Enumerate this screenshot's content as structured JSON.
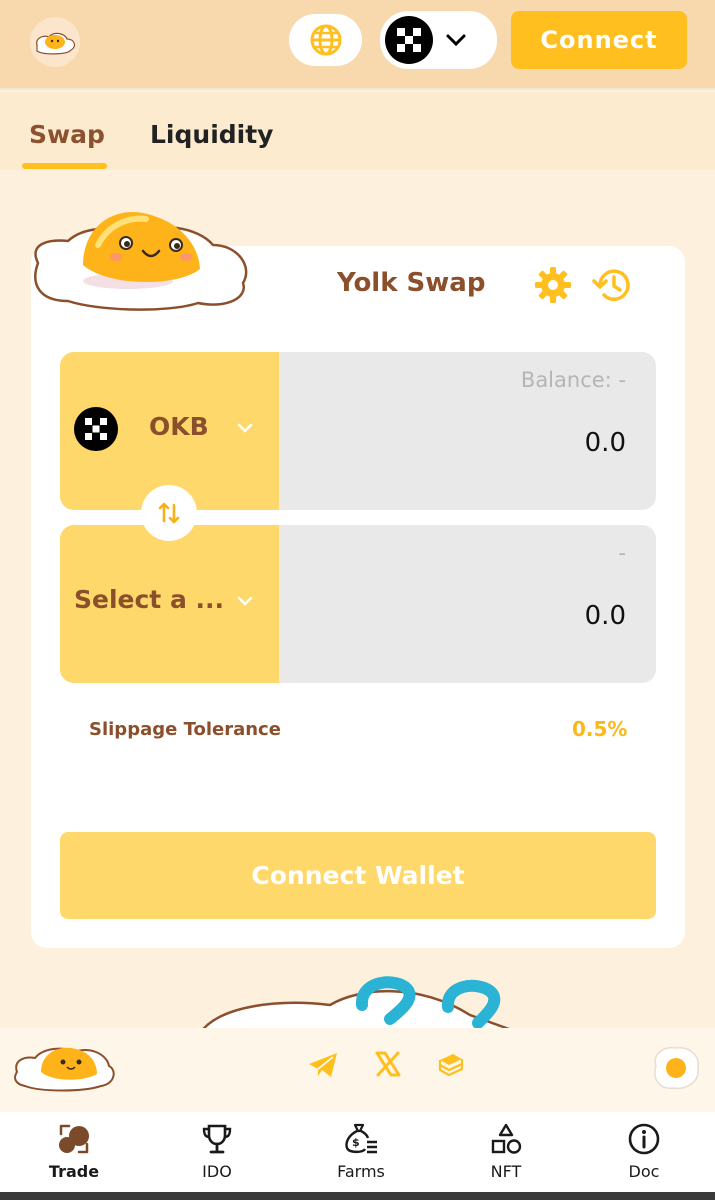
{
  "header": {
    "connect_label": "Connect",
    "chain_token": "OKB"
  },
  "tabs": [
    {
      "label": "Swap",
      "active": true
    },
    {
      "label": "Liquidity",
      "active": false
    }
  ],
  "card": {
    "title": "Yolk Swap",
    "from": {
      "token": "OKB",
      "balance": "Balance: -",
      "amount": "0.0"
    },
    "to": {
      "token": "Select a ...",
      "balance": "-",
      "amount": "0.0"
    },
    "slippage_label": "Slippage Tolerance",
    "slippage_value": "0.5%",
    "connect_wallet_label": "Connect Wallet"
  },
  "nav": [
    {
      "label": "Trade",
      "icon": "trade-icon",
      "active": true
    },
    {
      "label": "IDO",
      "icon": "trophy-icon",
      "active": false
    },
    {
      "label": "Farms",
      "icon": "money-bag-icon",
      "active": false
    },
    {
      "label": "NFT",
      "icon": "shapes-icon",
      "active": false
    },
    {
      "label": "Doc",
      "icon": "info-icon",
      "active": false
    }
  ],
  "colors": {
    "accent": "#ffbf1f",
    "brown": "#8b4f2c",
    "pale_yellow": "#ffd86b"
  }
}
